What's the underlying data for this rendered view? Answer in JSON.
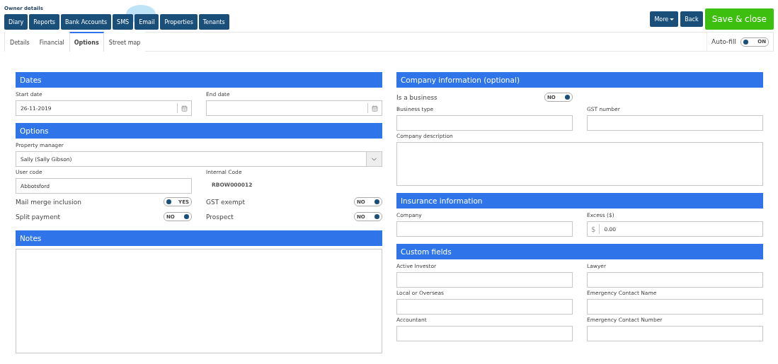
{
  "page_title": "Owner details",
  "toolbar": [
    {
      "label": "Diary"
    },
    {
      "label": "Reports"
    },
    {
      "label": "Bank Accounts"
    },
    {
      "label": "SMS"
    },
    {
      "label": "Email"
    },
    {
      "label": "Properties"
    },
    {
      "label": "Tenants"
    }
  ],
  "actions": [
    {
      "kind": "dropdown",
      "label": "More"
    },
    {
      "kind": "plain",
      "label": "Back"
    },
    {
      "kind": "primary",
      "label": "Save & close"
    }
  ],
  "tabs": [
    {
      "label": "Details",
      "selected": false
    },
    {
      "label": "Financial",
      "selected": false
    },
    {
      "label": "Options",
      "selected": true
    },
    {
      "label": "Street map",
      "selected": false
    }
  ],
  "auto_fill": {
    "label": "Auto-fill",
    "on": true,
    "state_text": "ON"
  },
  "left_column": [
    {
      "title": "Dates",
      "rows": [
        [
          {
            "kind": "date",
            "label": "Start date",
            "value": "26-11-2019"
          },
          {
            "kind": "date",
            "label": "End date"
          }
        ]
      ]
    },
    {
      "title": "Options",
      "rows": [
        [
          {
            "kind": "select",
            "label": "Property manager",
            "value": "Sally (Sally Gibson)"
          }
        ],
        [
          {
            "kind": "text",
            "label": "User code",
            "value": "Abbotsford"
          },
          {
            "kind": "readonly",
            "label": "Internal Code",
            "value": "RBOW000012"
          }
        ],
        [
          {
            "kind": "toggle",
            "label": "Mail merge inclusion",
            "on": true,
            "state_text": "YES"
          },
          {
            "kind": "toggle",
            "label": "GST exempt",
            "on": false,
            "state_text": "NO"
          }
        ],
        [
          {
            "kind": "toggle",
            "label": "Split payment",
            "on": false,
            "state_text": "NO"
          },
          {
            "kind": "toggle",
            "label": "Prospect",
            "on": false,
            "state_text": "NO"
          }
        ]
      ]
    },
    {
      "title": "Notes",
      "rows": [
        [
          {
            "kind": "textarea"
          }
        ]
      ]
    }
  ],
  "right_column": [
    {
      "title": "Company information (optional)",
      "rows": [
        [
          {
            "kind": "toggle",
            "label": "Is a business",
            "on": false,
            "state_text": "NO"
          }
        ],
        [
          {
            "kind": "text",
            "label": "Business type"
          },
          {
            "kind": "text",
            "label": "GST number"
          }
        ],
        [
          {
            "kind": "textarea",
            "label": "Company description"
          }
        ]
      ]
    },
    {
      "title": "Insurance information",
      "rows": [
        [
          {
            "kind": "text",
            "label": "Company"
          },
          {
            "kind": "money",
            "label": "Excess ($)",
            "prefix": "$",
            "value": "0.00"
          }
        ]
      ]
    },
    {
      "title": "Custom fields",
      "rows": [
        [
          {
            "kind": "text",
            "label": "Active Investor"
          },
          {
            "kind": "text",
            "label": "Lawyer"
          }
        ],
        [
          {
            "kind": "text",
            "label": "Local or Overseas"
          },
          {
            "kind": "text",
            "label": "Emergency Contact Name"
          }
        ],
        [
          {
            "kind": "text",
            "label": "Accountant"
          },
          {
            "kind": "text",
            "label": "Emergency Contact Number"
          }
        ]
      ]
    }
  ]
}
